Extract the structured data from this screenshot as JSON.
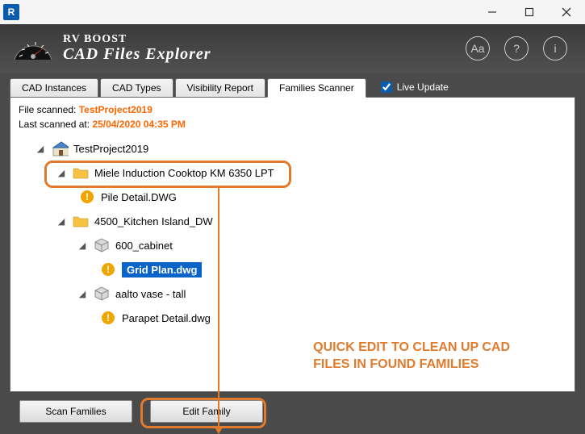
{
  "titlebar": {
    "app_letter": "R"
  },
  "header": {
    "brand": "RV BOOST",
    "title": "CAD Files Explorer"
  },
  "tabs": [
    "CAD Instances",
    "CAD Types",
    "Visibility Report",
    "Families Scanner"
  ],
  "active_tab_index": 3,
  "live_update_label": "Live Update",
  "info": {
    "scanned_label": "File scanned:",
    "scanned_value": "TestProject2019",
    "lastscan_label": "Last scanned at:",
    "lastscan_value": "25/04/2020 04:35 PM"
  },
  "tree": {
    "root": "TestProject2019",
    "n1": "Miele Induction Cooktop KM 6350 LPT",
    "n1a": "Pile Detail.DWG",
    "n2": "4500_Kitchen Island_DW",
    "n2a": "600_cabinet",
    "n2a1": "Grid Plan.dwg",
    "n2b": "aalto vase - tall",
    "n2b1": "Parapet Detail.dwg"
  },
  "annotation": {
    "line1": "QUICK EDIT TO CLEAN UP CAD",
    "line2": "FILES IN FOUND FAMILIES"
  },
  "footer": {
    "scan": "Scan Families",
    "edit": "Edit Family"
  }
}
